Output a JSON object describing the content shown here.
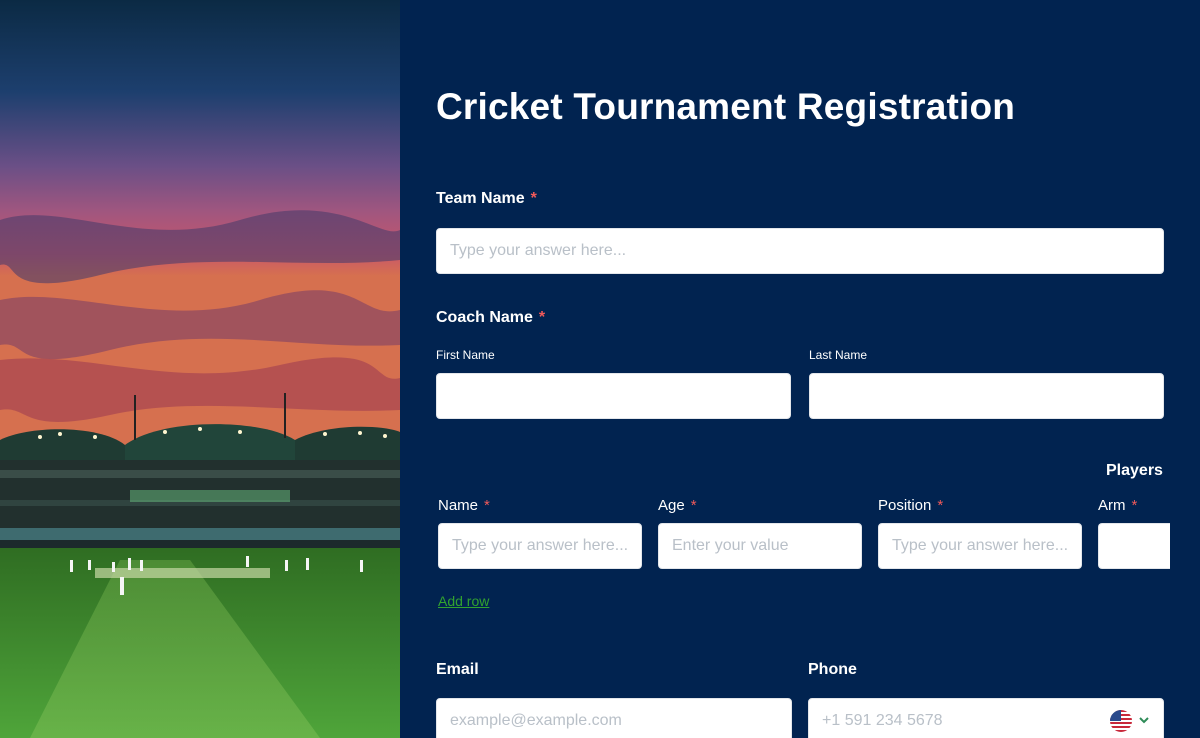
{
  "form": {
    "title": "Cricket Tournament Registration",
    "team_name": {
      "label": "Team Name",
      "required_mark": "*",
      "placeholder": "Type your answer here..."
    },
    "coach_name": {
      "label": "Coach Name",
      "required_mark": "*",
      "first_name_label": "First Name",
      "last_name_label": "Last Name"
    },
    "players": {
      "label": "Players",
      "columns": [
        {
          "label": "Name",
          "required_mark": "*",
          "placeholder": "Type your answer here..."
        },
        {
          "label": "Age",
          "required_mark": "*",
          "placeholder": "Enter your value"
        },
        {
          "label": "Position",
          "required_mark": "*",
          "placeholder": "Type your answer here..."
        },
        {
          "label": "Arm",
          "required_mark": "*",
          "placeholder": ""
        }
      ],
      "add_row_label": "Add row"
    },
    "email": {
      "label": "Email",
      "placeholder": "example@example.com"
    },
    "phone": {
      "label": "Phone",
      "placeholder": "+1 591 234 5678",
      "country_icon": "us-flag-icon",
      "dropdown_icon": "chevron-down-icon"
    }
  },
  "colors": {
    "panel_bg": "#012350",
    "required": "#f05a5a",
    "link": "#31a32f"
  }
}
